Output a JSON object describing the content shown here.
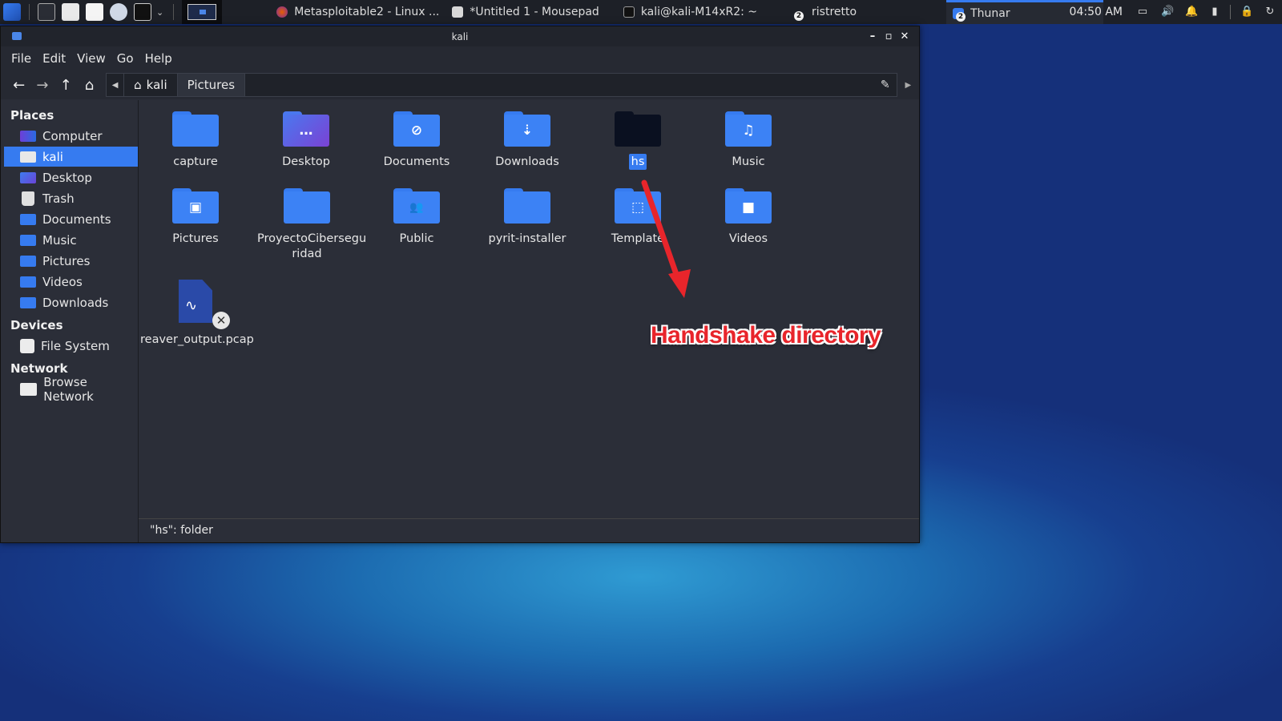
{
  "panel": {
    "tasks": [
      {
        "label": "Metasploitable2 - Linux ...",
        "icon": "firefox-icon"
      },
      {
        "label": "*Untitled 1 - Mousepad",
        "icon": "mousepad-icon"
      },
      {
        "label": "kali@kali-M14xR2: ~",
        "icon": "terminal-icon"
      },
      {
        "label": "ristretto",
        "icon": "image-viewer-icon",
        "badge": "2"
      },
      {
        "label": "Thunar",
        "icon": "thunar-icon",
        "badge": "2"
      }
    ],
    "clock": "04:50 AM"
  },
  "window": {
    "title": "kali",
    "menu": [
      "File",
      "Edit",
      "View",
      "Go",
      "Help"
    ],
    "breadcrumbs": [
      "kali",
      "Pictures"
    ]
  },
  "sidebar": {
    "places_title": "Places",
    "places": [
      "Computer",
      "kali",
      "Desktop",
      "Trash",
      "Documents",
      "Music",
      "Pictures",
      "Videos",
      "Downloads"
    ],
    "devices_title": "Devices",
    "devices": [
      "File System"
    ],
    "network_title": "Network",
    "network": [
      "Browse Network"
    ]
  },
  "files": [
    {
      "name": "capture",
      "glyph": ""
    },
    {
      "name": "Desktop",
      "glyph": "…"
    },
    {
      "name": "Documents",
      "glyph": "⊘"
    },
    {
      "name": "Downloads",
      "glyph": "⇣"
    },
    {
      "name": "hs",
      "glyph": ""
    },
    {
      "name": "Music",
      "glyph": "♫"
    },
    {
      "name": "Pictures",
      "glyph": "▣"
    },
    {
      "name": "ProyectoCibersegu ridad",
      "glyph": ""
    },
    {
      "name": "Public",
      "glyph": "👥"
    },
    {
      "name": "pyrit-installer",
      "glyph": ""
    },
    {
      "name": "Template",
      "glyph": "⬚"
    },
    {
      "name": "Videos",
      "glyph": "■"
    },
    {
      "name": "reaver_output.pcap",
      "glyph": "∿"
    }
  ],
  "status": "\"hs\": folder",
  "annotation": "Handshake directory",
  "colors": {
    "accent": "#367bf0",
    "annotation": "#e8252b"
  }
}
